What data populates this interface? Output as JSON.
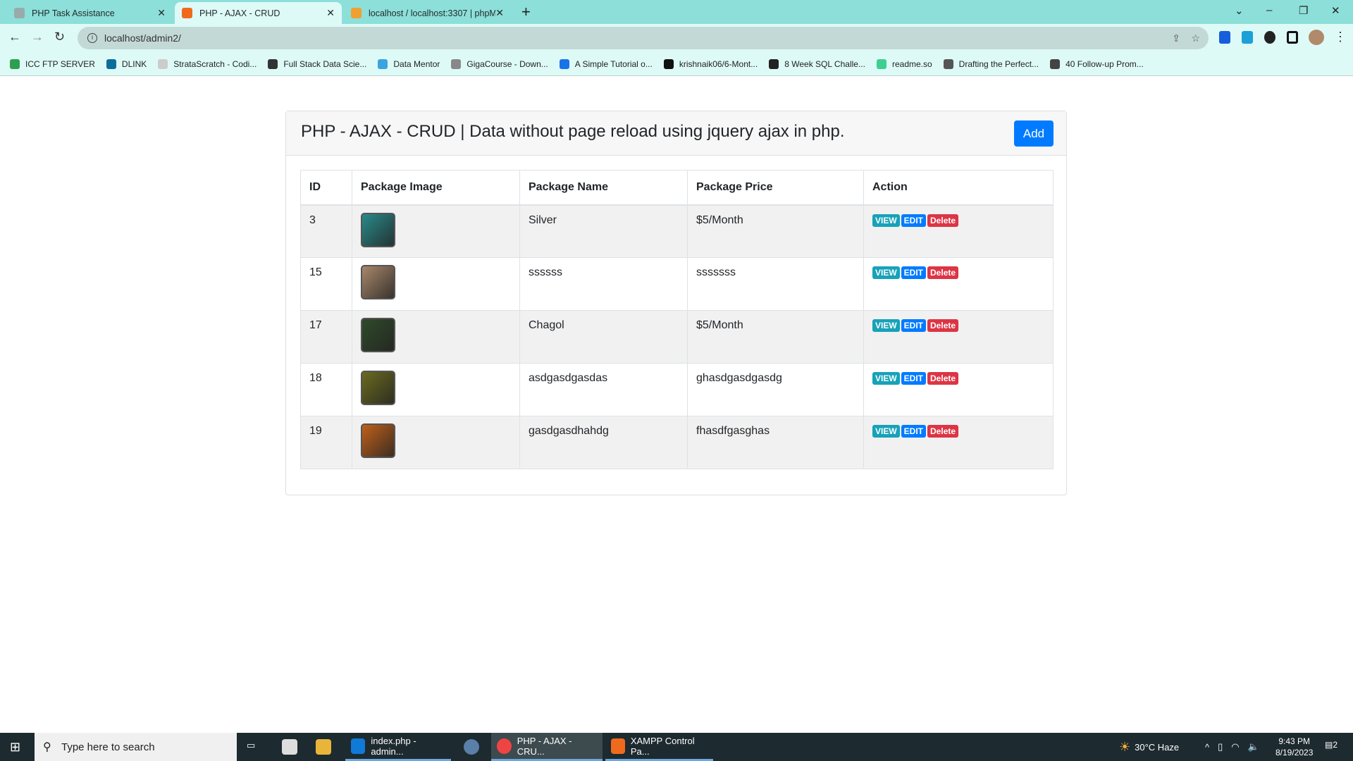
{
  "browser": {
    "tabs": [
      {
        "label": "PHP Task Assistance",
        "icon": "chatgpt-icon"
      },
      {
        "label": "PHP - AJAX - CRUD",
        "icon": "xampp-icon",
        "active": true
      },
      {
        "label": "localhost / localhost:3307 | phpM",
        "icon": "phpmyadmin-icon"
      }
    ],
    "url": "localhost/admin2/",
    "bookmarks": [
      {
        "label": "ICC FTP SERVER",
        "color": "#2e9e4f"
      },
      {
        "label": "DLINK",
        "color": "#0b6e99"
      },
      {
        "label": "StrataScratch - Codi...",
        "color": "#cccccc"
      },
      {
        "label": "Full Stack Data Scie...",
        "color": "#333333"
      },
      {
        "label": "Data Mentor",
        "color": "#3ba3e0"
      },
      {
        "label": "GigaCourse - Down...",
        "color": "#888888"
      },
      {
        "label": "A Simple Tutorial o...",
        "color": "#1a73e8"
      },
      {
        "label": "krishnaik06/6-Mont...",
        "color": "#111111"
      },
      {
        "label": "8 Week SQL Challe...",
        "color": "#222222"
      },
      {
        "label": "readme.so",
        "color": "#3ccf91"
      },
      {
        "label": "Drafting the Perfect...",
        "color": "#555555"
      },
      {
        "label": "40 Follow-up Prom...",
        "color": "#444444"
      }
    ]
  },
  "page": {
    "title": "PHP - AJAX - CRUD | Data without page reload using jquery ajax in php.",
    "add_label": "Add",
    "columns": [
      "ID",
      "Package Image",
      "Package Name",
      "Package Price",
      "Action"
    ],
    "actions": {
      "view": "VIEW",
      "edit": "EDIT",
      "delete": "Delete"
    },
    "rows": [
      {
        "id": "3",
        "name": "Silver",
        "price": "$5/Month",
        "thumb": "#2a8a8a"
      },
      {
        "id": "15",
        "name": "ssssss",
        "price": "sssssss",
        "thumb": "#a8876a"
      },
      {
        "id": "17",
        "name": "Chagol",
        "price": "$5/Month",
        "thumb": "#2f4a2a"
      },
      {
        "id": "18",
        "name": "asdgasdgasdas",
        "price": "ghasdgasdgasdg",
        "thumb": "#6a6a20"
      },
      {
        "id": "19",
        "name": "gasdgasdhahdg",
        "price": "fhasdfgasghas",
        "thumb": "#c0601a"
      }
    ]
  },
  "taskbar": {
    "search_placeholder": "Type here to search",
    "apps": [
      "index.php - admin...",
      "PHP - AJAX - CRU...",
      "XAMPP Control Pa..."
    ],
    "weather": "30°C  Haze",
    "time": "9:43 PM",
    "date": "8/19/2023",
    "notifications": "2"
  }
}
